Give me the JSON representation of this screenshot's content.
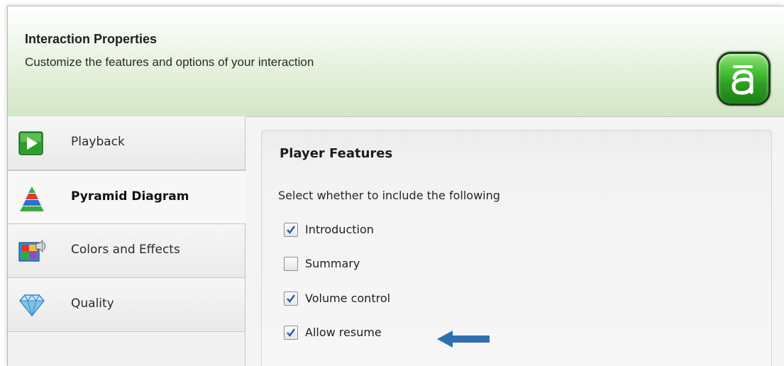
{
  "header": {
    "title": "Interaction Properties",
    "subtitle": "Customize the features and options of your interaction",
    "logo_icon": "articulate-logo-icon"
  },
  "sidebar": {
    "items": [
      {
        "label": "Playback",
        "icon": "play-icon",
        "selected": false
      },
      {
        "label": "Pyramid Diagram",
        "icon": "pyramid-icon",
        "selected": true
      },
      {
        "label": "Colors and Effects",
        "icon": "colors-effects-icon",
        "selected": false
      },
      {
        "label": "Quality",
        "icon": "diamond-icon",
        "selected": false
      }
    ]
  },
  "panel": {
    "group_title": "Player Features",
    "instruction": "Select whether to include the following",
    "options": [
      {
        "label": "Introduction",
        "checked": true
      },
      {
        "label": "Summary",
        "checked": false
      },
      {
        "label": "Volume control",
        "checked": true
      },
      {
        "label": "Allow resume",
        "checked": true
      }
    ]
  },
  "colors": {
    "header_green": "#d2e7c6",
    "logo_green": "#3fb22f",
    "arrow_blue": "#2f6fb0",
    "check_blue": "#2d55a8"
  }
}
